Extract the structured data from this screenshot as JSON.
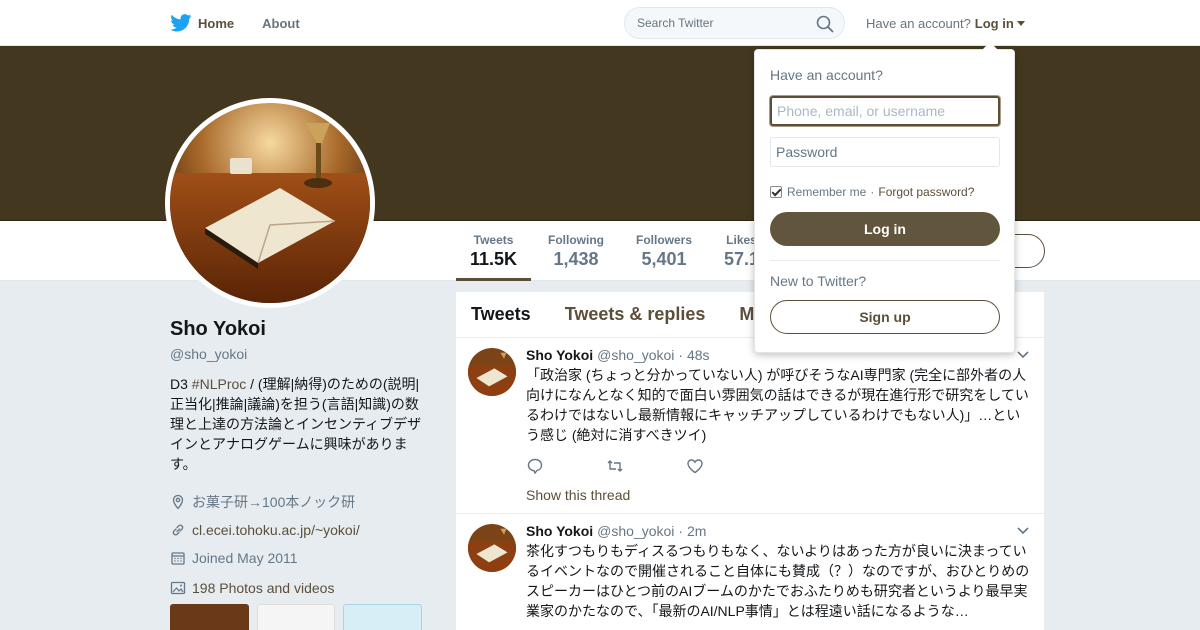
{
  "nav": {
    "home": "Home",
    "about": "About",
    "search_placeholder": "Search Twitter",
    "have_account": "Have an account?",
    "login": "Log in"
  },
  "stats": [
    {
      "label": "Tweets",
      "value": "11.5K"
    },
    {
      "label": "Following",
      "value": "1,438"
    },
    {
      "label": "Followers",
      "value": "5,401"
    },
    {
      "label": "Likes",
      "value": "57.1"
    }
  ],
  "profile": {
    "name": "Sho Yokoi",
    "handle": "@sho_yokoi",
    "bio_prefix": "D3 ",
    "bio_hashtag": "#NLProc",
    "bio_rest": " / (理解|納得)のための(説明|正当化|推論|議論)を担う(言語|知識)の数理と上達の方法論とインセンティブデザインとアナログゲームに興味があります。",
    "location": "お菓子研→100本ノック研",
    "url": "cl.ecei.tohoku.ac.jp/~yokoi/",
    "joined": "Joined May 2011",
    "photos": "198 Photos and videos"
  },
  "timeline": {
    "tabs": [
      "Tweets",
      "Tweets & replies",
      "Media"
    ],
    "tweets": [
      {
        "name": "Sho Yokoi",
        "handle": "@sho_yokoi",
        "time": "· 48s",
        "text": "「政治家 (ちょっと分かっていない人) が呼びそうなAI専門家 (完全に部外者の人向けになんとなく知的で面白い雰囲気の話はできるが現在進行形で研究をしているわけではないし最新情報にキャッチアップしているわけでもない人)」…という感じ (絶対に消すべきツイ)",
        "thread": "Show this thread"
      },
      {
        "name": "Sho Yokoi",
        "handle": "@sho_yokoi",
        "time": "· 2m",
        "text": "茶化すつもりもディスるつもりもなく、ないよりはあった方が良いに決まっているイベントなので開催されること自体にも賛成（？）なのですが、おひとりめのスピーカーはひとつ前のAIブームのかたでおふたりめも研究者というより最早実業家のかたなので、「最新のAI/NLP事情」とは程遠い話になるような…"
      }
    ]
  },
  "login_dropdown": {
    "title": "Have an account?",
    "username_placeholder": "Phone, email, or username",
    "password_placeholder": "Password",
    "remember": "Remember me",
    "separator": "·",
    "forgot": "Forgot password?",
    "login_button": "Log in",
    "new_to_twitter": "New to Twitter?",
    "signup_button": "Sign up"
  },
  "colors": {
    "accent": "#5c4f3a",
    "banner": "#43381f",
    "page_bg": "#e6ecf0"
  }
}
